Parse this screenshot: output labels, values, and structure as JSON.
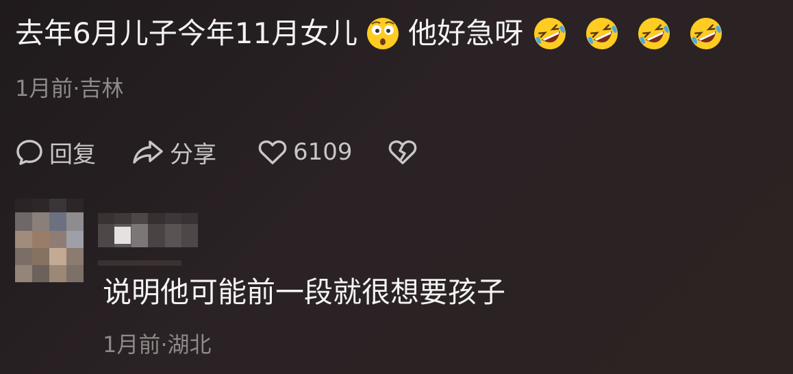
{
  "comment": {
    "text_part1": "去年6月儿子今年11月女儿",
    "text_part2": "他好急呀",
    "emoji_after_part1": "shocked-face-emoji",
    "emoji_after_part2": [
      "rolling-laughing-emoji",
      "rolling-laughing-emoji",
      "rolling-laughing-emoji",
      "rolling-laughing-emoji"
    ],
    "meta": "1月前·吉林"
  },
  "actions": {
    "reply_label": "回复",
    "share_label": "分享",
    "like_count": "6109",
    "icons": {
      "reply": "speech-bubble-icon",
      "share": "share-arrow-icon",
      "like": "heart-icon",
      "dislike": "broken-heart-icon"
    }
  },
  "reply": {
    "avatar": "blurred-avatar",
    "username": "blurred-username",
    "text": "说明他可能前一段就很想要孩子",
    "meta": "1月前·湖北"
  },
  "colors": {
    "background": "#241e1f",
    "text_primary": "#f3f3f3",
    "text_secondary": "#8d8a89",
    "action_text": "#c9c7c6",
    "emoji_yellow": "#ffcc22"
  }
}
